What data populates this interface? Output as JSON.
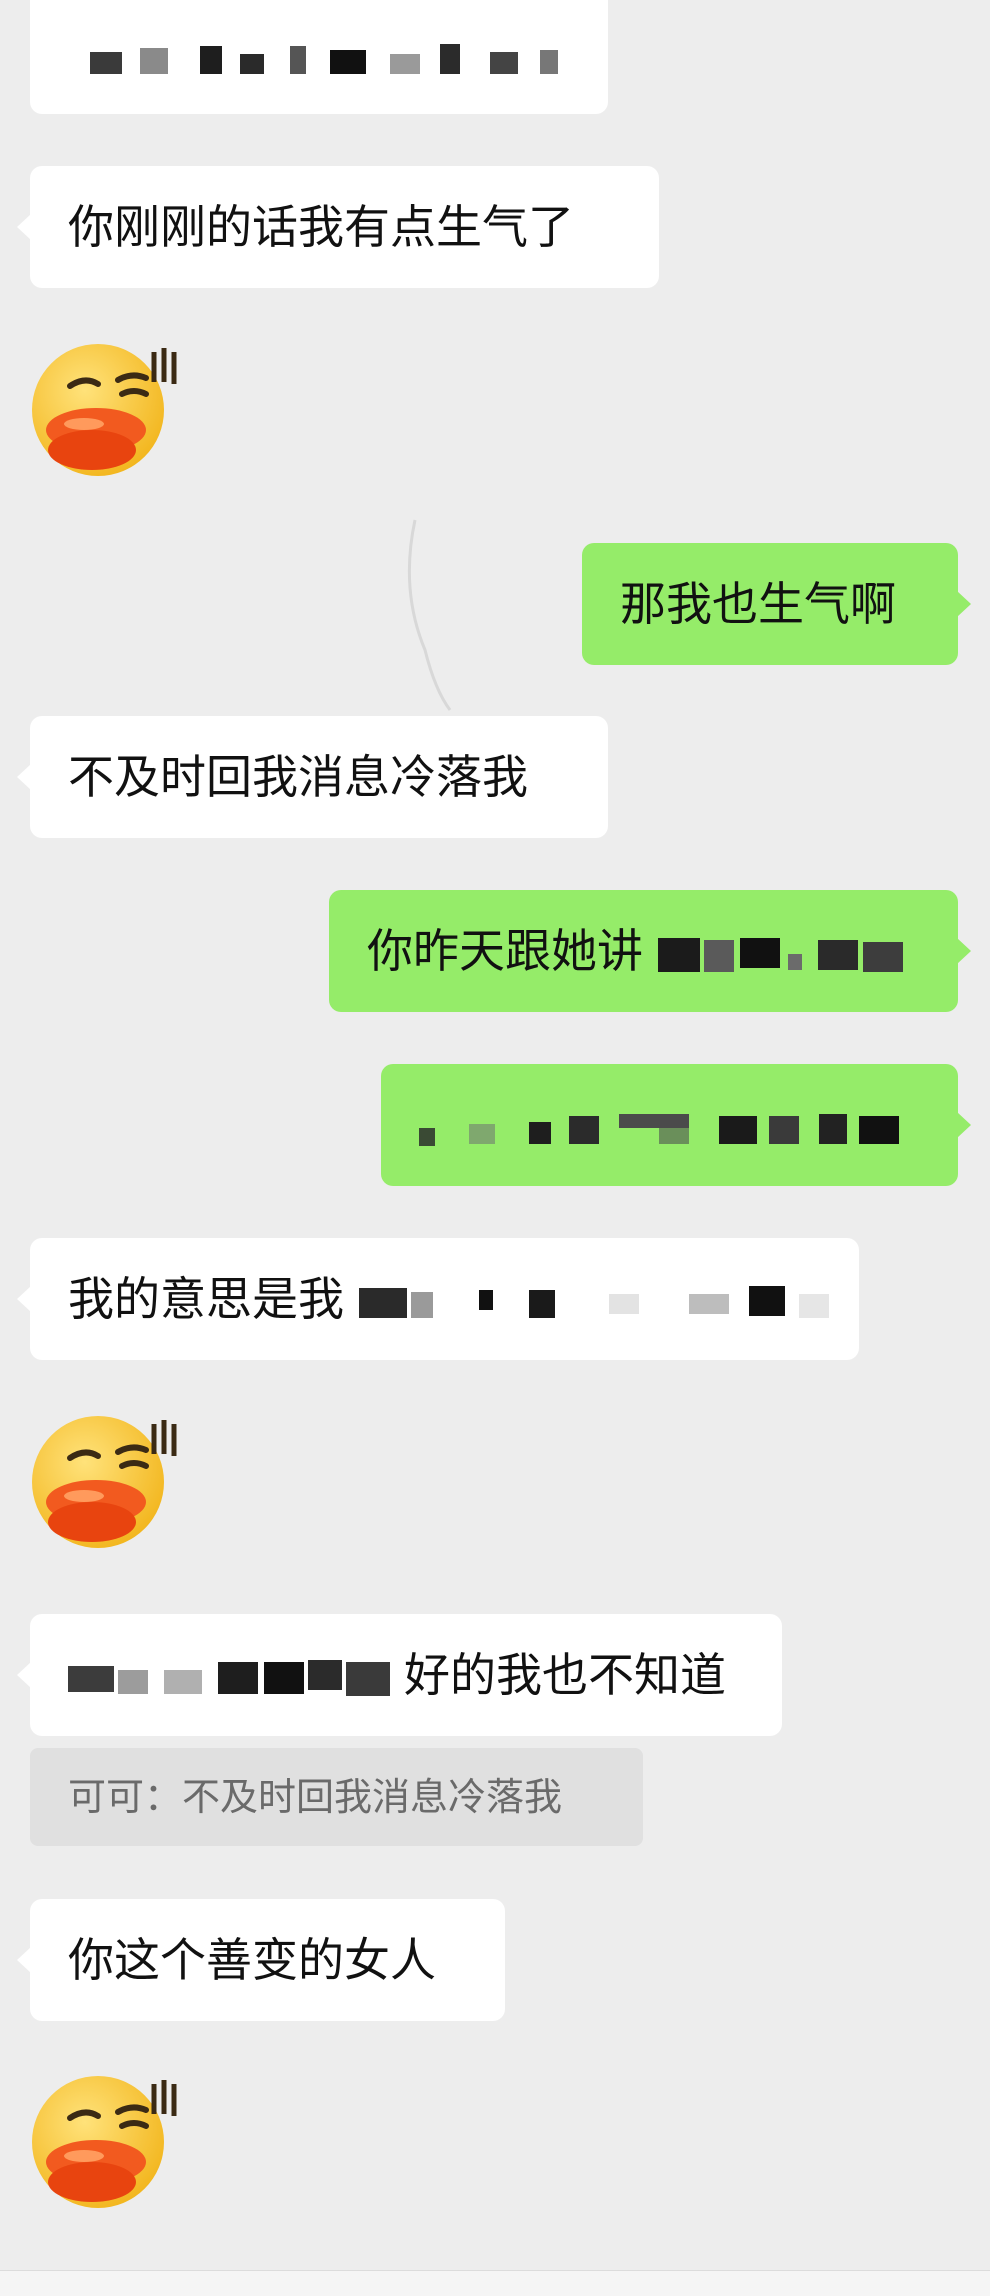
{
  "messages": [
    {
      "id": "m1",
      "side": "in",
      "text": "你刚刚的话我有点生气了"
    },
    {
      "id": "m2",
      "side": "out",
      "text": "那我也生气啊"
    },
    {
      "id": "m3",
      "side": "in",
      "text": "不及时回我消息冷落我"
    },
    {
      "id": "m4",
      "side": "out",
      "text": "你昨天跟她讲"
    },
    {
      "id": "m5",
      "side": "in",
      "text": "我的意思是我"
    },
    {
      "id": "m6",
      "side": "in",
      "text": "好的我也不知道"
    },
    {
      "id": "m7",
      "side": "in",
      "text": "你这个善变的女人"
    }
  ],
  "quote": {
    "text": "可可：不及时回我消息冷落我"
  },
  "stickers": [
    {
      "name": "smirking-duck-face-sticker"
    },
    {
      "name": "smirking-duck-face-sticker"
    },
    {
      "name": "smirking-duck-face-sticker"
    }
  ],
  "colors": {
    "background": "#ededed",
    "incoming_bubble": "#ffffff",
    "outgoing_bubble": "#95ec69",
    "quote_bubble": "#e0e0e0",
    "sticker_face": "#f7cf3d",
    "sticker_lips": "#f25a1f"
  }
}
